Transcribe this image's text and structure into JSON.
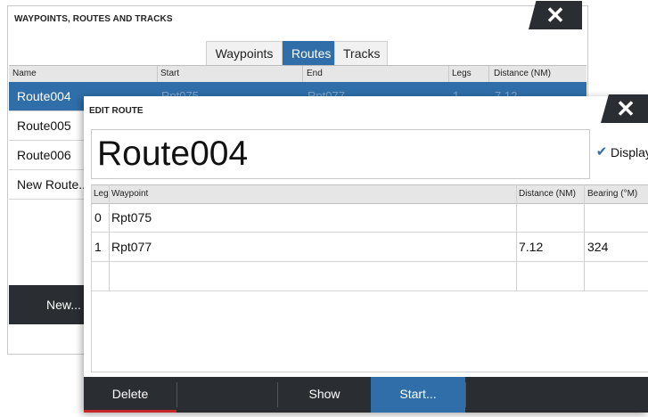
{
  "background_dialog": {
    "title": "WAYPOINTS, ROUTES AND TRACKS",
    "close_symbol": "✕",
    "tabs": [
      {
        "label": "Waypoints",
        "active": false
      },
      {
        "label": "Routes",
        "active": true
      },
      {
        "label": "Tracks",
        "active": false
      }
    ],
    "columns": [
      "Name",
      "Start",
      "End",
      "Legs",
      "Distance (NM)"
    ],
    "rows": [
      {
        "name": "Route004",
        "start": "Rpt075",
        "end": "Rpt077",
        "legs": "1",
        "distance": "7.12",
        "selected": true
      },
      {
        "name": "Route005"
      },
      {
        "name": "Route006"
      },
      {
        "name": "New Route..."
      }
    ],
    "new_button": "New..."
  },
  "edit_route": {
    "title": "EDIT ROUTE",
    "close_symbol": "✕",
    "route_name": "Route004",
    "display_label": "Display",
    "display_checked": true,
    "columns": {
      "leg": "Leg",
      "waypoint": "Waypoint",
      "distance": "Distance (NM)",
      "bearing": "Bearing (°M)"
    },
    "rows": [
      {
        "leg": "0",
        "waypoint": "Rpt075",
        "distance": "",
        "bearing": ""
      },
      {
        "leg": "1",
        "waypoint": "Rpt077",
        "distance": "7.12",
        "bearing": "324"
      },
      {
        "leg": "",
        "waypoint": "",
        "distance": "",
        "bearing": ""
      }
    ],
    "buttons": {
      "delete": "Delete",
      "show": "Show",
      "start": "Start..."
    }
  },
  "colors": {
    "accent": "#2f6ea8",
    "dark_bar": "#2a2e33",
    "delete_underline": "#c62828"
  },
  "icons": {
    "close": "close-icon",
    "check": "checkmark-icon"
  }
}
